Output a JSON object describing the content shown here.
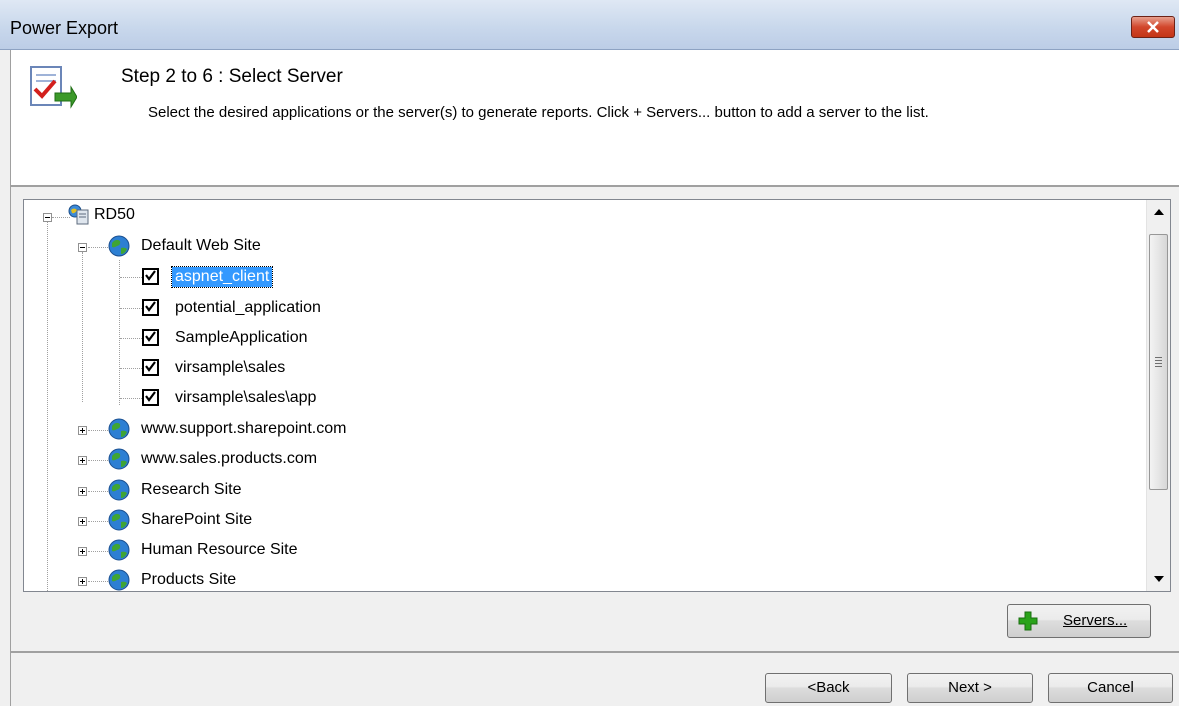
{
  "window": {
    "title": "Power Export"
  },
  "header": {
    "step_title": "Step 2 to 6 : Select Server",
    "description": "Select the desired applications or the server(s) to generate reports. Click + Servers... button to add a server to the list."
  },
  "tree": {
    "server": {
      "label": "RD50",
      "expanded": true
    },
    "default_site": {
      "label": "Default Web Site",
      "expanded": true
    },
    "applications": [
      {
        "label": "aspnet_client",
        "checked": true,
        "selected": true
      },
      {
        "label": "potential_application",
        "checked": true
      },
      {
        "label": "SampleApplication",
        "checked": true
      },
      {
        "label": "virsample\\sales",
        "checked": true
      },
      {
        "label": "virsample\\sales\\app",
        "checked": true
      }
    ],
    "other_sites": [
      {
        "label": "www.support.sharepoint.com",
        "expanded": false
      },
      {
        "label": "www.sales.products.com",
        "expanded": false
      },
      {
        "label": "Research Site",
        "expanded": false
      },
      {
        "label": "SharePoint Site",
        "expanded": false
      },
      {
        "label": "Human Resource Site",
        "expanded": false
      },
      {
        "label": "Products Site",
        "expanded": false
      }
    ]
  },
  "buttons": {
    "servers": "Servers...",
    "back": "<Back",
    "next": "Next >",
    "cancel": "Cancel"
  },
  "colors": {
    "selection": "#3399ff",
    "titlebar": "#c9d8ec",
    "close": "#c33516",
    "plus_icon": "#2aa31a"
  }
}
